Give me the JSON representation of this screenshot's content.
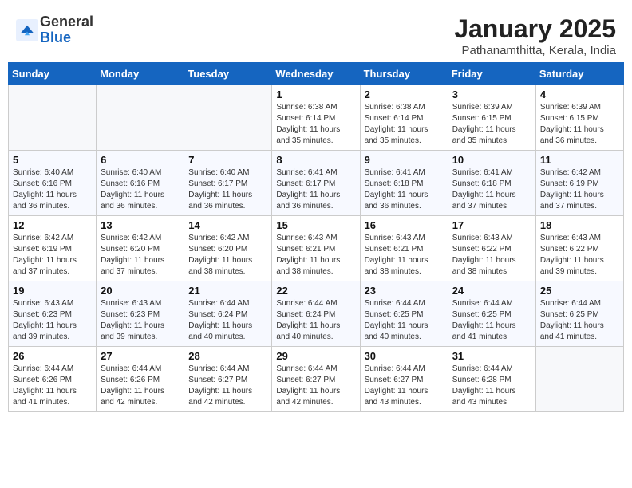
{
  "header": {
    "logo_general": "General",
    "logo_blue": "Blue",
    "month_title": "January 2025",
    "location": "Pathanamthitta, Kerala, India"
  },
  "weekdays": [
    "Sunday",
    "Monday",
    "Tuesday",
    "Wednesday",
    "Thursday",
    "Friday",
    "Saturday"
  ],
  "weeks": [
    [
      {
        "day": "",
        "info": ""
      },
      {
        "day": "",
        "info": ""
      },
      {
        "day": "",
        "info": ""
      },
      {
        "day": "1",
        "info": "Sunrise: 6:38 AM\nSunset: 6:14 PM\nDaylight: 11 hours\nand 35 minutes."
      },
      {
        "day": "2",
        "info": "Sunrise: 6:38 AM\nSunset: 6:14 PM\nDaylight: 11 hours\nand 35 minutes."
      },
      {
        "day": "3",
        "info": "Sunrise: 6:39 AM\nSunset: 6:15 PM\nDaylight: 11 hours\nand 35 minutes."
      },
      {
        "day": "4",
        "info": "Sunrise: 6:39 AM\nSunset: 6:15 PM\nDaylight: 11 hours\nand 36 minutes."
      }
    ],
    [
      {
        "day": "5",
        "info": "Sunrise: 6:40 AM\nSunset: 6:16 PM\nDaylight: 11 hours\nand 36 minutes."
      },
      {
        "day": "6",
        "info": "Sunrise: 6:40 AM\nSunset: 6:16 PM\nDaylight: 11 hours\nand 36 minutes."
      },
      {
        "day": "7",
        "info": "Sunrise: 6:40 AM\nSunset: 6:17 PM\nDaylight: 11 hours\nand 36 minutes."
      },
      {
        "day": "8",
        "info": "Sunrise: 6:41 AM\nSunset: 6:17 PM\nDaylight: 11 hours\nand 36 minutes."
      },
      {
        "day": "9",
        "info": "Sunrise: 6:41 AM\nSunset: 6:18 PM\nDaylight: 11 hours\nand 36 minutes."
      },
      {
        "day": "10",
        "info": "Sunrise: 6:41 AM\nSunset: 6:18 PM\nDaylight: 11 hours\nand 37 minutes."
      },
      {
        "day": "11",
        "info": "Sunrise: 6:42 AM\nSunset: 6:19 PM\nDaylight: 11 hours\nand 37 minutes."
      }
    ],
    [
      {
        "day": "12",
        "info": "Sunrise: 6:42 AM\nSunset: 6:19 PM\nDaylight: 11 hours\nand 37 minutes."
      },
      {
        "day": "13",
        "info": "Sunrise: 6:42 AM\nSunset: 6:20 PM\nDaylight: 11 hours\nand 37 minutes."
      },
      {
        "day": "14",
        "info": "Sunrise: 6:42 AM\nSunset: 6:20 PM\nDaylight: 11 hours\nand 38 minutes."
      },
      {
        "day": "15",
        "info": "Sunrise: 6:43 AM\nSunset: 6:21 PM\nDaylight: 11 hours\nand 38 minutes."
      },
      {
        "day": "16",
        "info": "Sunrise: 6:43 AM\nSunset: 6:21 PM\nDaylight: 11 hours\nand 38 minutes."
      },
      {
        "day": "17",
        "info": "Sunrise: 6:43 AM\nSunset: 6:22 PM\nDaylight: 11 hours\nand 38 minutes."
      },
      {
        "day": "18",
        "info": "Sunrise: 6:43 AM\nSunset: 6:22 PM\nDaylight: 11 hours\nand 39 minutes."
      }
    ],
    [
      {
        "day": "19",
        "info": "Sunrise: 6:43 AM\nSunset: 6:23 PM\nDaylight: 11 hours\nand 39 minutes."
      },
      {
        "day": "20",
        "info": "Sunrise: 6:43 AM\nSunset: 6:23 PM\nDaylight: 11 hours\nand 39 minutes."
      },
      {
        "day": "21",
        "info": "Sunrise: 6:44 AM\nSunset: 6:24 PM\nDaylight: 11 hours\nand 40 minutes."
      },
      {
        "day": "22",
        "info": "Sunrise: 6:44 AM\nSunset: 6:24 PM\nDaylight: 11 hours\nand 40 minutes."
      },
      {
        "day": "23",
        "info": "Sunrise: 6:44 AM\nSunset: 6:25 PM\nDaylight: 11 hours\nand 40 minutes."
      },
      {
        "day": "24",
        "info": "Sunrise: 6:44 AM\nSunset: 6:25 PM\nDaylight: 11 hours\nand 41 minutes."
      },
      {
        "day": "25",
        "info": "Sunrise: 6:44 AM\nSunset: 6:25 PM\nDaylight: 11 hours\nand 41 minutes."
      }
    ],
    [
      {
        "day": "26",
        "info": "Sunrise: 6:44 AM\nSunset: 6:26 PM\nDaylight: 11 hours\nand 41 minutes."
      },
      {
        "day": "27",
        "info": "Sunrise: 6:44 AM\nSunset: 6:26 PM\nDaylight: 11 hours\nand 42 minutes."
      },
      {
        "day": "28",
        "info": "Sunrise: 6:44 AM\nSunset: 6:27 PM\nDaylight: 11 hours\nand 42 minutes."
      },
      {
        "day": "29",
        "info": "Sunrise: 6:44 AM\nSunset: 6:27 PM\nDaylight: 11 hours\nand 42 minutes."
      },
      {
        "day": "30",
        "info": "Sunrise: 6:44 AM\nSunset: 6:27 PM\nDaylight: 11 hours\nand 43 minutes."
      },
      {
        "day": "31",
        "info": "Sunrise: 6:44 AM\nSunset: 6:28 PM\nDaylight: 11 hours\nand 43 minutes."
      },
      {
        "day": "",
        "info": ""
      }
    ]
  ]
}
